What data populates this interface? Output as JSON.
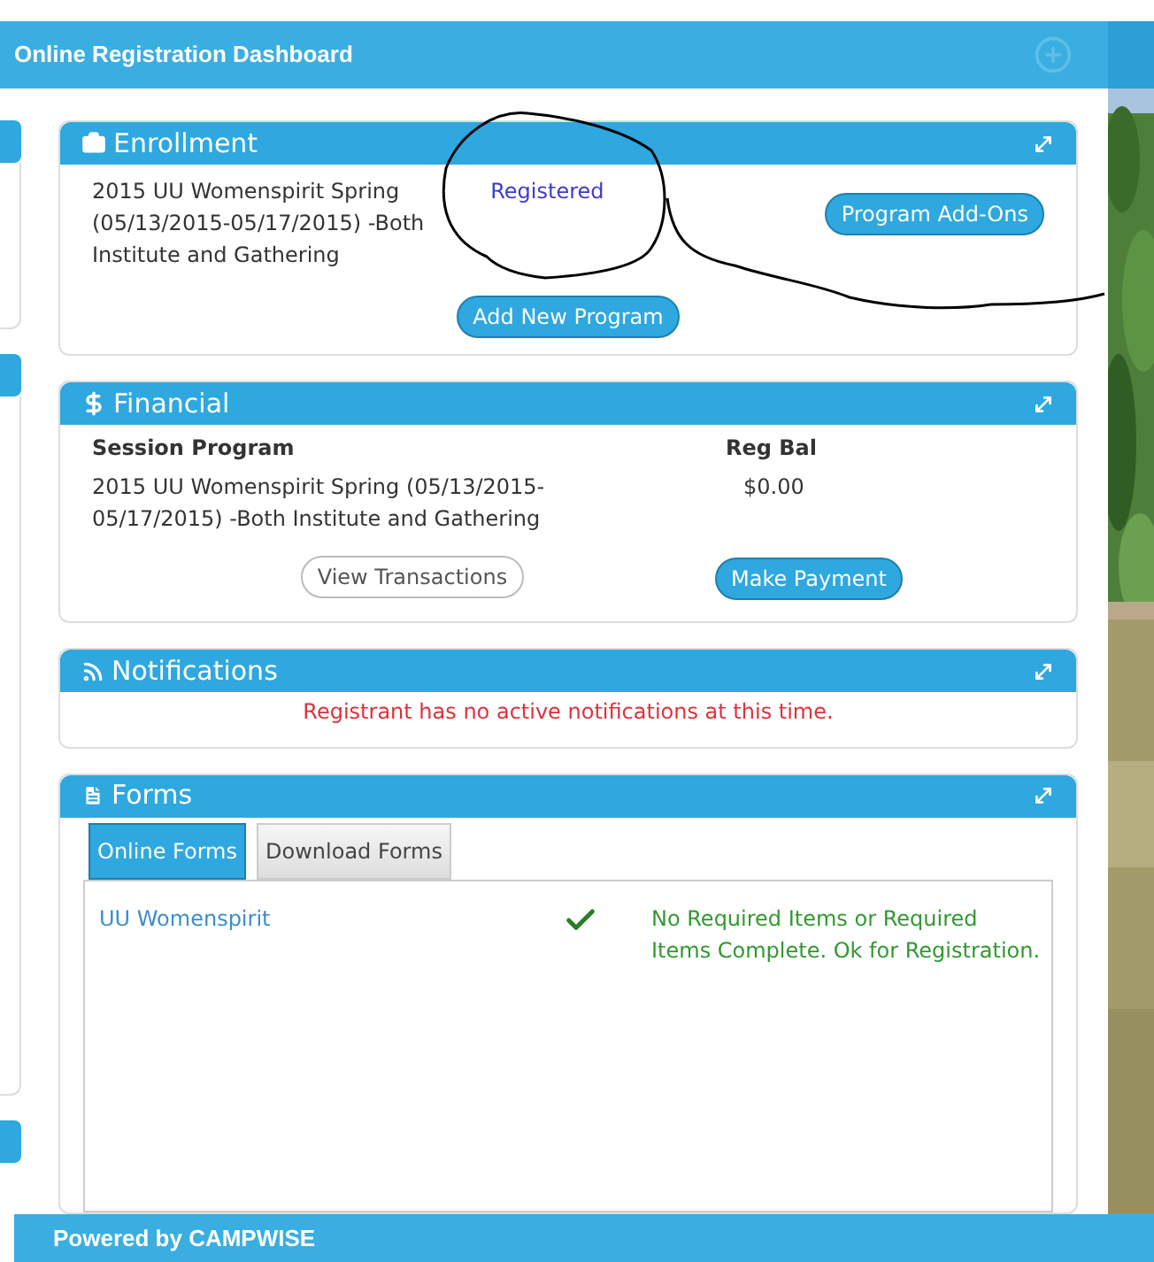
{
  "header": {
    "title": "Online Registration Dashboard"
  },
  "enrollment": {
    "title": "Enrollment",
    "program": "2015 UU Womenspirit Spring (05/13/2015-05/17/2015) -Both Institute and Gathering",
    "status": "Registered",
    "addons_button": "Program Add-Ons",
    "add_button": "Add New Program"
  },
  "financial": {
    "title": "Financial",
    "columns": [
      "Session Program",
      "Reg Bal"
    ],
    "rows": [
      {
        "program": "2015 UU Womenspirit Spring (05/13/2015-05/17/2015) -Both Institute and Gathering",
        "balance": "$0.00"
      }
    ],
    "view_button": "View Transactions",
    "pay_button": "Make Payment"
  },
  "notifications": {
    "title": "Notifications",
    "message": "Registrant has no active notifications at this time."
  },
  "forms": {
    "title": "Forms",
    "tabs": [
      {
        "label": "Online Forms",
        "selected": true
      },
      {
        "label": "Download Forms",
        "selected": false
      }
    ],
    "rows": [
      {
        "name": "UU Womenspirit",
        "complete": true,
        "status": "No Required Items or Required Items Complete. Ok for Registration."
      }
    ]
  },
  "footer": {
    "text": "Powered by CAMPWISE"
  }
}
